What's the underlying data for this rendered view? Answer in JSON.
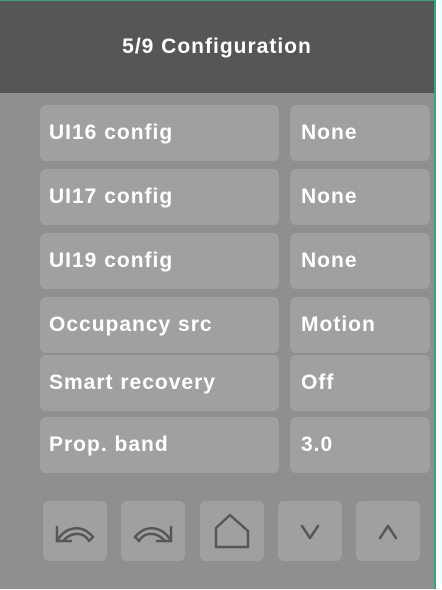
{
  "header": {
    "title": "5/9 Configuration"
  },
  "settings": [
    {
      "label": "UI16 config",
      "value": "None"
    },
    {
      "label": "UI17 config",
      "value": "None"
    },
    {
      "label": "UI19 config",
      "value": "None"
    },
    {
      "label": "Occupancy src",
      "value": "Motion"
    },
    {
      "label": "Smart recovery",
      "value": "Off"
    },
    {
      "label": "Prop. band",
      "value": "3.0"
    }
  ],
  "toolbar": {
    "buttons": [
      {
        "name": "undo-icon"
      },
      {
        "name": "redo-icon"
      },
      {
        "name": "home-icon"
      },
      {
        "name": "chevron-down-icon"
      },
      {
        "name": "chevron-up-icon"
      }
    ]
  },
  "colors": {
    "header_bg": "#555656",
    "panel_bg": "#8f8f8f",
    "cell_bg": "#a0a0a0",
    "text": "#ffffff",
    "accent_border": "#3aa37a"
  }
}
